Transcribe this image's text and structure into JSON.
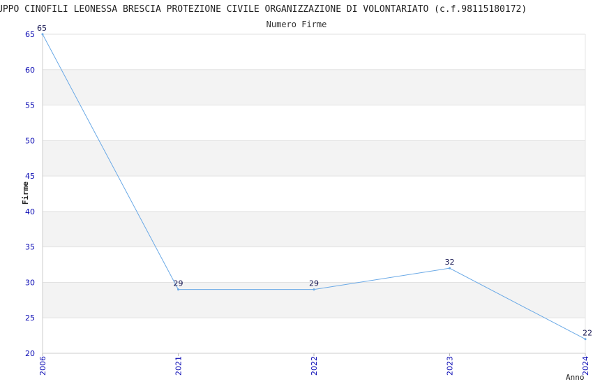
{
  "header": {
    "title": "UPPO CINOFILI LEONESSA BRESCIA PROTEZIONE CIVILE ORGANIZZAZIONE DI VOLONTARIATO (c.f.98115180172)",
    "subtitle": "Numero Firme"
  },
  "chart_data": {
    "type": "line",
    "title": "UPPO CINOFILI LEONESSA BRESCIA PROTEZIONE CIVILE ORGANIZZAZIONE DI VOLONTARIATO (c.f.98115180172)",
    "subtitle": "Numero Firme",
    "xlabel": "Anno",
    "ylabel": "Firme",
    "categories": [
      "2006",
      "2021",
      "2022",
      "2023",
      "2024"
    ],
    "series": [
      {
        "name": "",
        "values": [
          65,
          29,
          29,
          32,
          22
        ]
      }
    ],
    "ylim": [
      20,
      65
    ],
    "yticks": [
      20,
      25,
      30,
      35,
      40,
      45,
      50,
      55,
      60,
      65
    ],
    "grid": true,
    "band_color": "#f3f3f3",
    "line_color": "#6aa9e6"
  }
}
